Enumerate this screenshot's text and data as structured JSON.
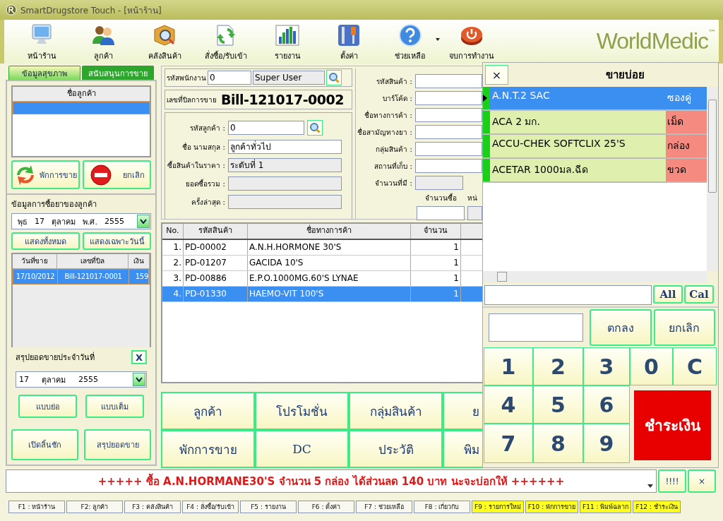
{
  "window": {
    "title": "SmartDrugstore Touch - [หน้าร้าน]"
  },
  "toolbar": [
    {
      "label": "หน้าร้าน",
      "kind": "monitor"
    },
    {
      "label": "ลูกค้า",
      "kind": "people"
    },
    {
      "label": "คลังสินค้า",
      "kind": "box"
    },
    {
      "label": "สั่งซื้อ/รับเข้า",
      "kind": "exchange"
    },
    {
      "label": "รายงาน",
      "kind": "chart"
    },
    {
      "label": "ตั้งค่า",
      "kind": "tools"
    },
    {
      "label": "ช่วยเหลือ",
      "kind": "help"
    },
    {
      "label": "จบการทำงาน",
      "kind": "power"
    }
  ],
  "logo": {
    "text": "WorldMedic",
    "mark": "™"
  },
  "left_panel": {
    "tabs": [
      {
        "label": "ข้อมูลสุขภาพ",
        "selected": true
      },
      {
        "label": "สนับสนุนการขาย",
        "selected": false
      }
    ],
    "customer_list": {
      "column": "ชื่อลูกค้า",
      "rows": [
        {
          "selected": true
        }
      ]
    },
    "buttons": [
      {
        "label": "พักการขาย",
        "kind": "recycle"
      },
      {
        "label": "ยกเลิก",
        "kind": "stop"
      }
    ],
    "history": {
      "title": "ข้อมูลการซื้อยาของลูกค้า",
      "date": [
        "พุธ",
        "17",
        "ตุลาคม",
        "พ.ศ.",
        "2555"
      ],
      "buttons": [
        "แสดงทั้งหมด",
        "แสดงเฉพาะวันนี้"
      ],
      "columns": [
        "วันที่ขาย",
        "เลขที่บิล",
        "เงิน"
      ],
      "rows": [
        {
          "cells": [
            "17/10/2012",
            "Bill-121017-0001",
            "159"
          ],
          "selected": true
        }
      ]
    },
    "summary": {
      "title": "สรุปยอดขายประจำวันที่",
      "close": "X",
      "date": [
        "17",
        "ตุลาคม",
        "2555"
      ],
      "buttons": [
        "แบบย่อ",
        "แบบเต็ม"
      ]
    },
    "bottom_buttons": [
      "เปิดลิ้นชัก",
      "สรุปยอดขาย"
    ]
  },
  "sale": {
    "employee": {
      "label": "รหัสพนักงาน",
      "code": "0",
      "name": "Super User"
    },
    "bill": {
      "label": "เลขที่บิลการขาย",
      "number": "Bill-121017-0002"
    },
    "customer_fields": [
      {
        "label": "รหัสลูกค้า :",
        "value": "0",
        "kind": "search"
      },
      {
        "label": "ชื่อ นามสกุล :",
        "value": "ลูกค้าทั่วไป",
        "kind": "text"
      },
      {
        "label": "ซื้อสินค้าในราคา :",
        "value": "ระดับที่ 1",
        "kind": "readonly"
      },
      {
        "label": "ยอดซื้อรวม :",
        "kind": "readonly"
      },
      {
        "label": "ครั้งล่าสุด :",
        "kind": "readonly"
      }
    ],
    "product_fields": [
      {
        "label": "รหัสสินค้า :",
        "kind": "text"
      },
      {
        "label": "บาร์โค้ด :",
        "kind": "text"
      },
      {
        "label": "ชื่อทางการค้า :",
        "kind": "text"
      },
      {
        "label": "ชื่อสามัญทางยา :",
        "kind": "text"
      },
      {
        "label": "กลุ่มสินค้า :",
        "kind": "text"
      },
      {
        "label": "สถานที่เก็บ :",
        "kind": "text"
      },
      {
        "label": "จำนวนที่มี :",
        "kind": "readonly"
      }
    ],
    "quantity_labels": [
      "จำนวนซื้อ",
      "หน่"
    ],
    "items": {
      "columns": [
        "No.",
        "รหัสสินค้า",
        "ชื่อทางการค้า",
        "จำนวน"
      ],
      "rows": [
        {
          "cells": [
            "1.",
            "PD-00002",
            "A.N.H.HORMONE 30'S",
            "1"
          ],
          "selected": false
        },
        {
          "cells": [
            "2.",
            "PD-01207",
            "GACIDA 10'S",
            "1"
          ],
          "selected": false
        },
        {
          "cells": [
            "3.",
            "PD-00886",
            "E.P.O.1000MG.60'S  LYNAE",
            "1"
          ],
          "selected": false
        },
        {
          "cells": [
            "4.",
            "PD-01330",
            "HAEMO-VIT 100'S",
            "1"
          ],
          "selected": true
        }
      ]
    },
    "action_buttons": [
      [
        "ลูกค้า",
        "โปรโมชั่น",
        "กลุ่มสินค้า",
        "ย"
      ],
      [
        "พักการขาย",
        "DC",
        "ประวัติ",
        "พิม"
      ]
    ]
  },
  "popup": {
    "title": "ขายบ่อย",
    "close": "×",
    "rows": [
      {
        "name": "A.N.T.2 SAC",
        "unit": "ซองคู่",
        "selected": true
      },
      {
        "name": "ACA 2 มก.",
        "unit": "เม็ด",
        "selected": false
      },
      {
        "name": "ACCU-CHEK SOFTCLIX 25'S",
        "unit": "กล่อง",
        "selected": false
      },
      {
        "name": "ACETAR 1000มล.ฉีด",
        "unit": "ขวด",
        "selected": false
      }
    ],
    "filter_buttons": [
      "All",
      "Cal"
    ],
    "ok": "ตกลง",
    "cancel": "ยกเลิก",
    "keys": [
      "1",
      "2",
      "3",
      "0",
      "C",
      "4",
      "5",
      "6",
      "7",
      "8",
      "9"
    ],
    "pay": "ชำระเงิน"
  },
  "message": {
    "text": "+++++ ซื้อ A.N.HORMANE30'S จำนวน 5 กล่อง ได้ส่วนลด 140 บาท นะจะบ่อกให้ ++++++",
    "buttons": [
      "!!!!",
      "×"
    ]
  },
  "function_keys": [
    {
      "label": "F1 : หน้าร้าน",
      "highlighted": false
    },
    {
      "label": "F2: ลูกค้า",
      "highlighted": false
    },
    {
      "label": "F3 : คลังสินค้า",
      "highlighted": false
    },
    {
      "label": "F4 : สั่งซื้อ/รับเข้า",
      "highlighted": false
    },
    {
      "label": "F5 : รายงาน",
      "highlighted": false
    },
    {
      "label": "F6 : ตั้งค่า",
      "highlighted": false
    },
    {
      "label": "F7 : ช่วยเหลือ",
      "highlighted": false
    },
    {
      "label": "F8 : เกี่ยวกับ",
      "highlighted": false
    },
    {
      "label": "F9 : รายการใหม่",
      "highlighted": true
    },
    {
      "label": "F10 : พักการขาย",
      "highlighted": true
    },
    {
      "label": "F11 : พิมพ์ฉลาก",
      "highlighted": true
    },
    {
      "label": "F12 : ชำระเงิน",
      "highlighted": true
    }
  ]
}
